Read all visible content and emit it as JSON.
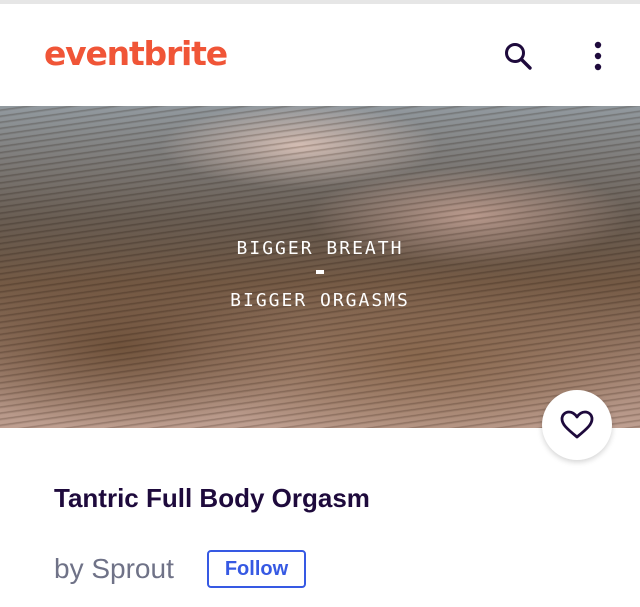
{
  "header": {
    "logo_text": "eventbrite",
    "logo_color": "#f05537",
    "search_icon": "search-icon",
    "more_icon": "more-vertical-icon"
  },
  "hero": {
    "line1": "BIGGER BREATH",
    "line2": "BIGGER ORGASMS",
    "like_icon": "heart-outline-icon"
  },
  "event": {
    "title": "Tantric Full Body Orgasm",
    "organizer": "by Sprout",
    "follow_label": "Follow",
    "title_color": "#1e0a3c",
    "accent_color": "#3659e3"
  }
}
